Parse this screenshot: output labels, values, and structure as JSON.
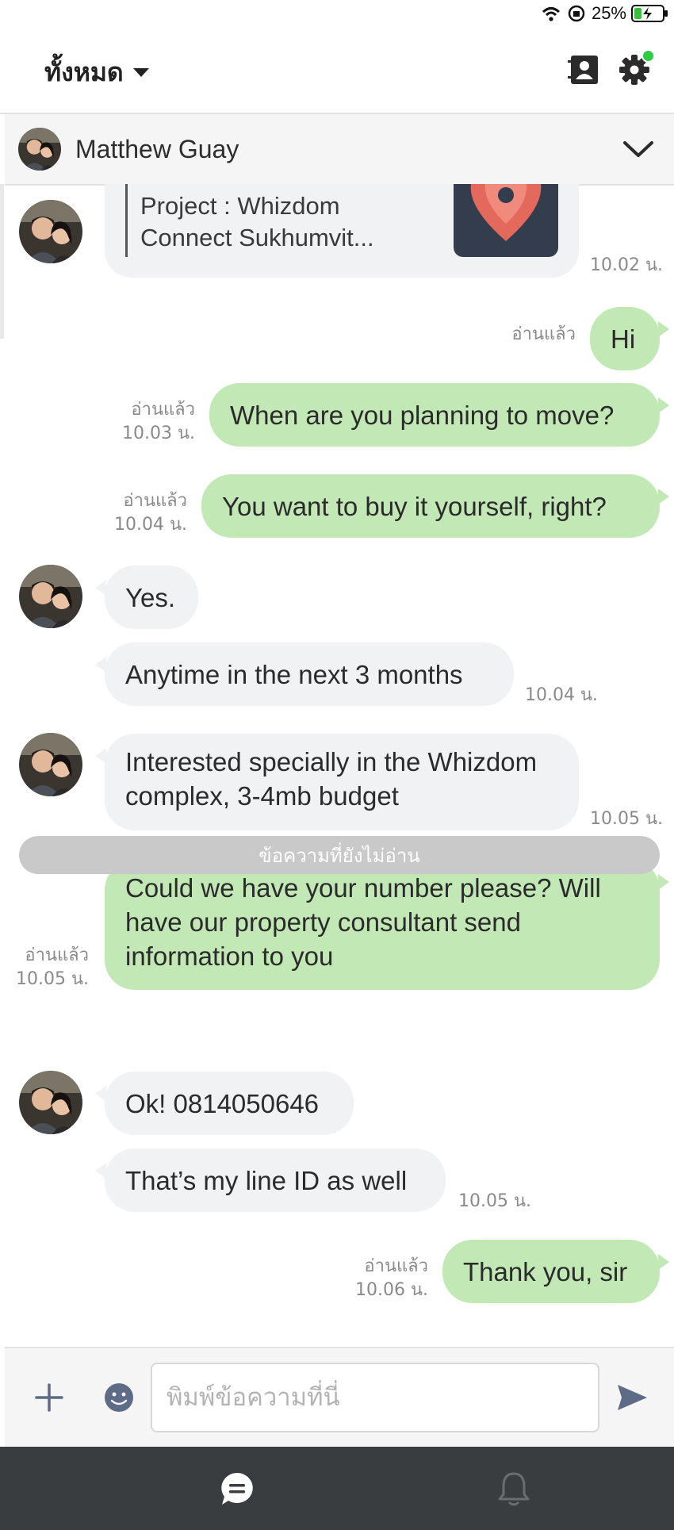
{
  "status_bar": {
    "battery_text": "25%",
    "battery_level": 0.25
  },
  "header": {
    "filter_label": "ทั้งหมด",
    "contacts_icon": "contact-book-icon",
    "settings_icon": "gear-icon",
    "settings_badge_color": "#2ecc40"
  },
  "contact": {
    "name": "Matthew Guay"
  },
  "project_card": {
    "text": "Project : Whizdom Connect Sukhumvit...",
    "time": "10.02 น."
  },
  "messages": [
    {
      "text": "Hi",
      "read": "อ่านแล้ว",
      "time": ""
    },
    {
      "text": "When are you planning to move?",
      "read": "อ่านแล้ว",
      "time": "10.03 น."
    },
    {
      "text": "You want to buy it yourself, right?",
      "read": "อ่านแล้ว",
      "time": "10.04 น."
    },
    {
      "text": "Yes.",
      "time": ""
    },
    {
      "text": "Anytime in the next 3 months",
      "time": "10.04 น."
    },
    {
      "text": "Interested specially in the Whizdom complex, 3-4mb budget",
      "time": "10.05 น."
    },
    {
      "text": "Could we have your number please? Will have our property consultant send information to you",
      "read": "อ่านแล้ว",
      "time": "10.05 น."
    },
    {
      "text": "Ok! 0814050646",
      "time": ""
    },
    {
      "text": "That’s my line ID as well",
      "time": "10.05 น."
    },
    {
      "text": "Thank you, sir",
      "read": "อ่านแล้ว",
      "time": "10.06 น."
    }
  ],
  "unread_divider": "ข้อความที่ยังไม่อ่าน",
  "composer": {
    "placeholder": "พิมพ์ข้อความที่นี่"
  },
  "colors": {
    "outgoing_bubble": "#c2e8b5",
    "incoming_bubble": "#f1f2f4",
    "bottom_nav": "#3a3d40"
  }
}
